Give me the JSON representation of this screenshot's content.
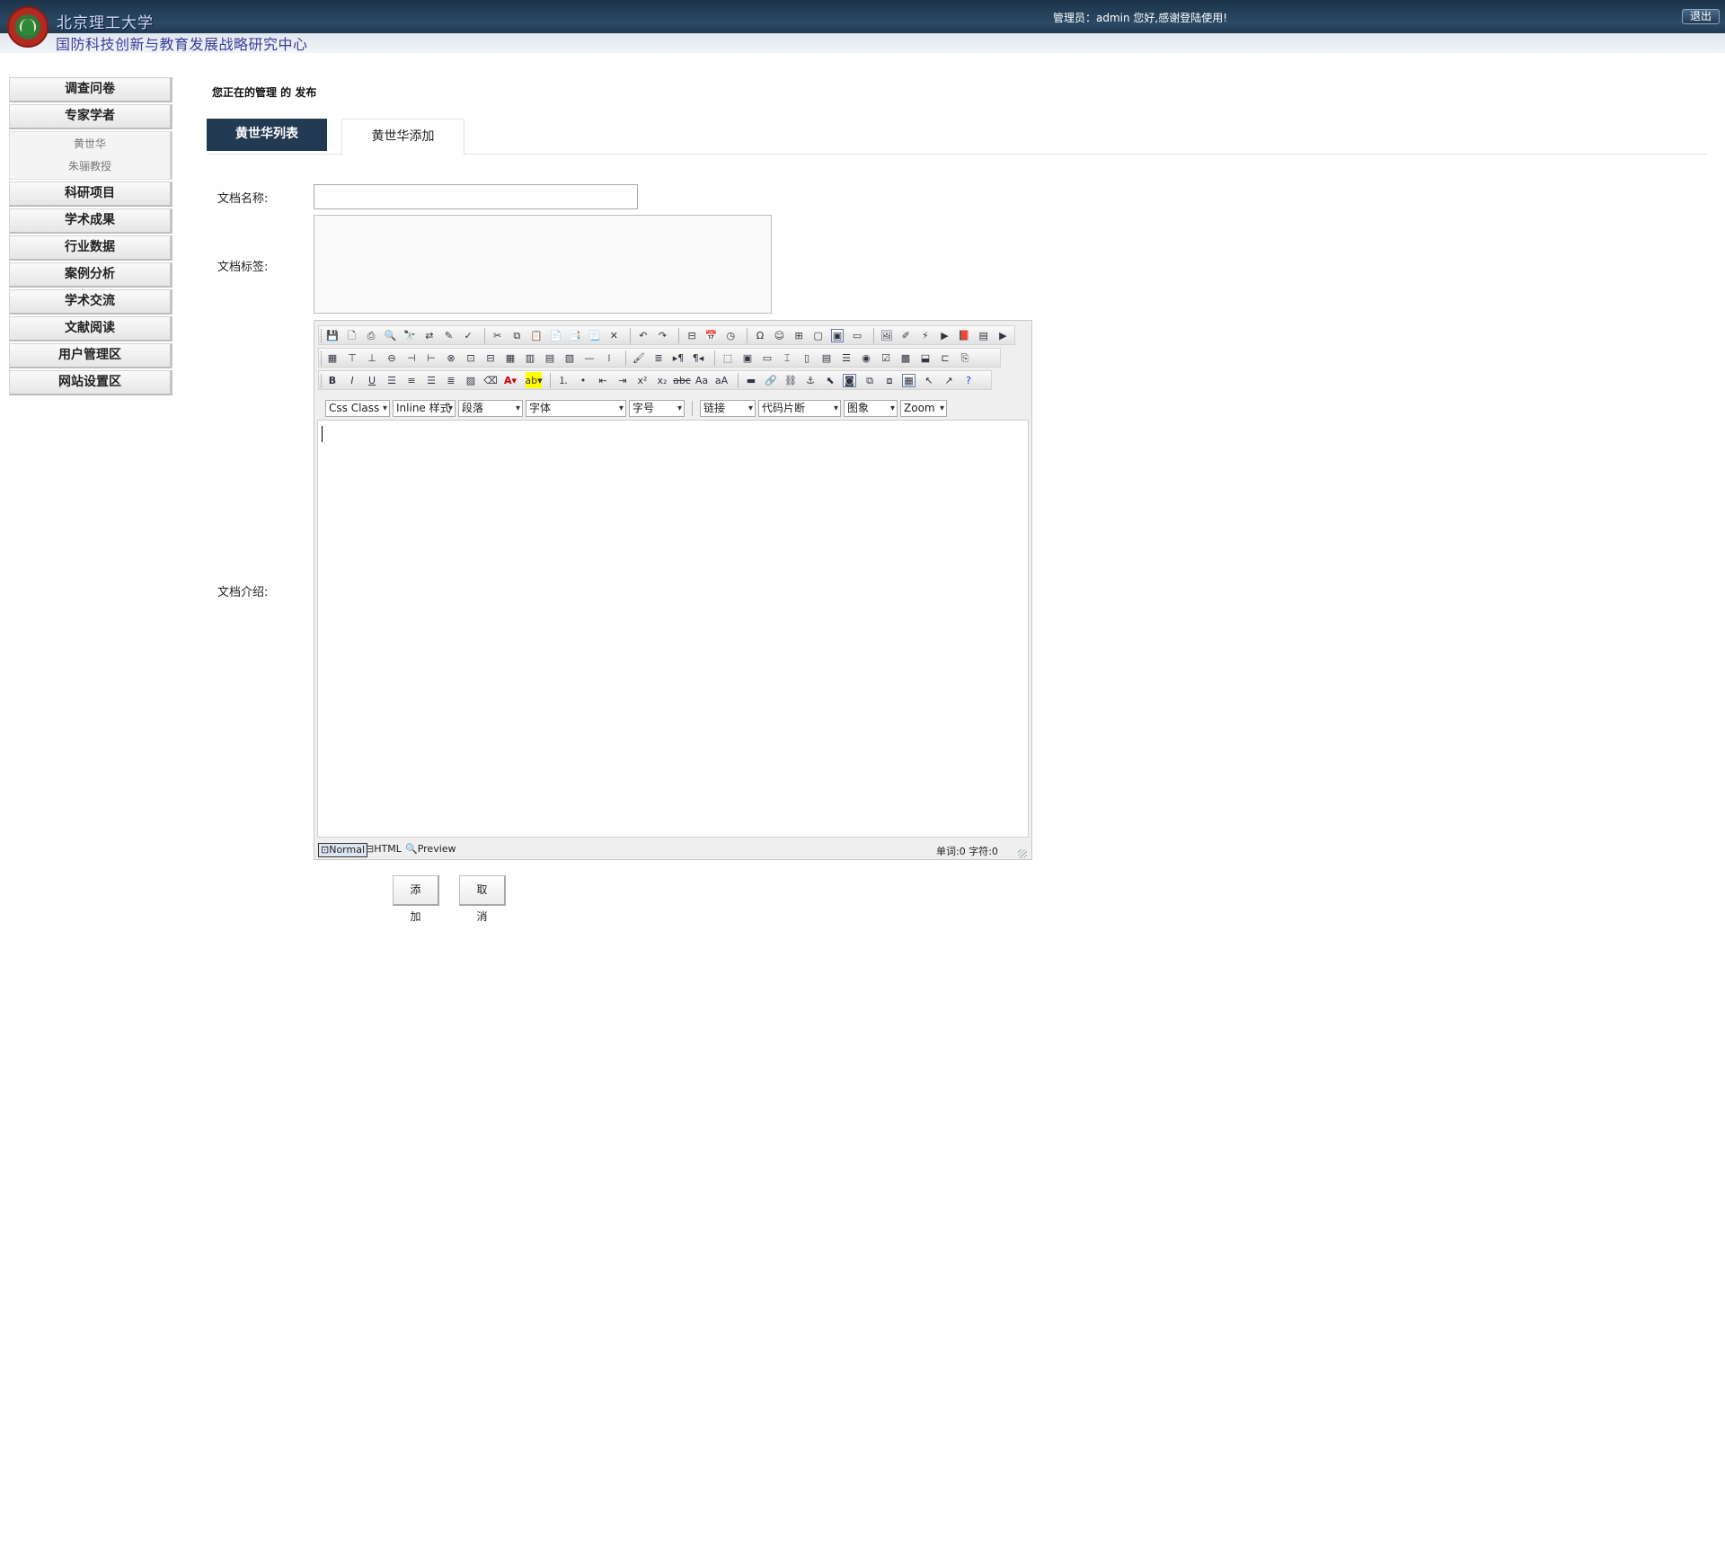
{
  "header": {
    "university": "北京理工大学",
    "center": "国防科技创新与教育发展战略研究中心",
    "admin_text": "管理员：admin 您好,感谢登陆使用!",
    "logout": "退出"
  },
  "sidebar": {
    "items": [
      {
        "label": "调查问卷"
      },
      {
        "label": "专家学者",
        "children": [
          "黄世华",
          "朱骊教授"
        ]
      },
      {
        "label": "科研项目"
      },
      {
        "label": "学术成果"
      },
      {
        "label": "行业数据"
      },
      {
        "label": "案例分析"
      },
      {
        "label": "学术交流"
      },
      {
        "label": "文献阅读"
      },
      {
        "label": "用户管理区"
      },
      {
        "label": "网站设置区"
      }
    ]
  },
  "main": {
    "breadcrumb": "您正在的管理 的 发布",
    "tabs": [
      {
        "label": "黄世华列表",
        "active": false
      },
      {
        "label": "黄世华添加",
        "active": true
      }
    ],
    "form": {
      "name_label": "文档名称:",
      "name_value": "",
      "tag_label": "文档标签:",
      "tag_value": "",
      "intro_label": "文档介绍:"
    },
    "editor": {
      "selects": [
        "Css Class",
        "Inline 样式",
        "段落",
        "字体",
        "字号",
        "链接",
        "代码片断",
        "图象",
        "Zoom"
      ],
      "modes": [
        "Normal",
        "HTML",
        "Preview"
      ],
      "counts": "单词:0 字符:0"
    },
    "buttons": {
      "add": "添 加",
      "cancel": "取 消"
    }
  },
  "colors": {
    "header_dark": "#1d3349",
    "tab_active": "#223a52",
    "center_text": "#3a3e9a"
  }
}
